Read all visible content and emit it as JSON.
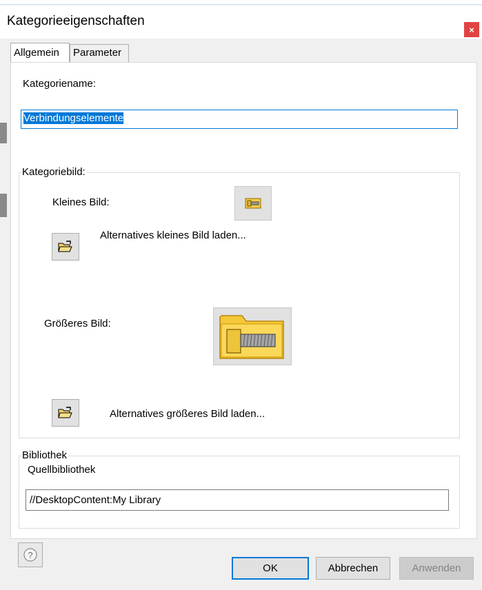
{
  "window": {
    "title": "Kategorieeigenschaften",
    "close_glyph": "×"
  },
  "tabs": [
    {
      "label": "Allgemein",
      "active": true
    },
    {
      "label": "Parameter",
      "active": false
    }
  ],
  "category_name": {
    "label": "Kategoriename:",
    "value": "Verbindungselemente"
  },
  "category_image": {
    "group_title": "Kategoriebild:",
    "small_label": "Kleines Bild:",
    "small_icon": "bolt-small-icon",
    "load_small_label": "Alternatives kleines Bild laden...",
    "large_label": "Größeres Bild:",
    "large_icon": "bolt-folder-icon",
    "load_large_label": "Alternatives größeres Bild laden...",
    "open_icon": "open-folder-icon"
  },
  "library": {
    "group_title": "Bibliothek",
    "source_label": "Quellbibliothek",
    "source_value": "//DesktopContent:My Library"
  },
  "buttons": {
    "ok": "OK",
    "cancel": "Abbrechen",
    "apply": "Anwenden",
    "help_icon": "help-icon"
  },
  "colors": {
    "accent": "#0078d7",
    "close": "#e04343",
    "folder": "#f2c94c"
  }
}
